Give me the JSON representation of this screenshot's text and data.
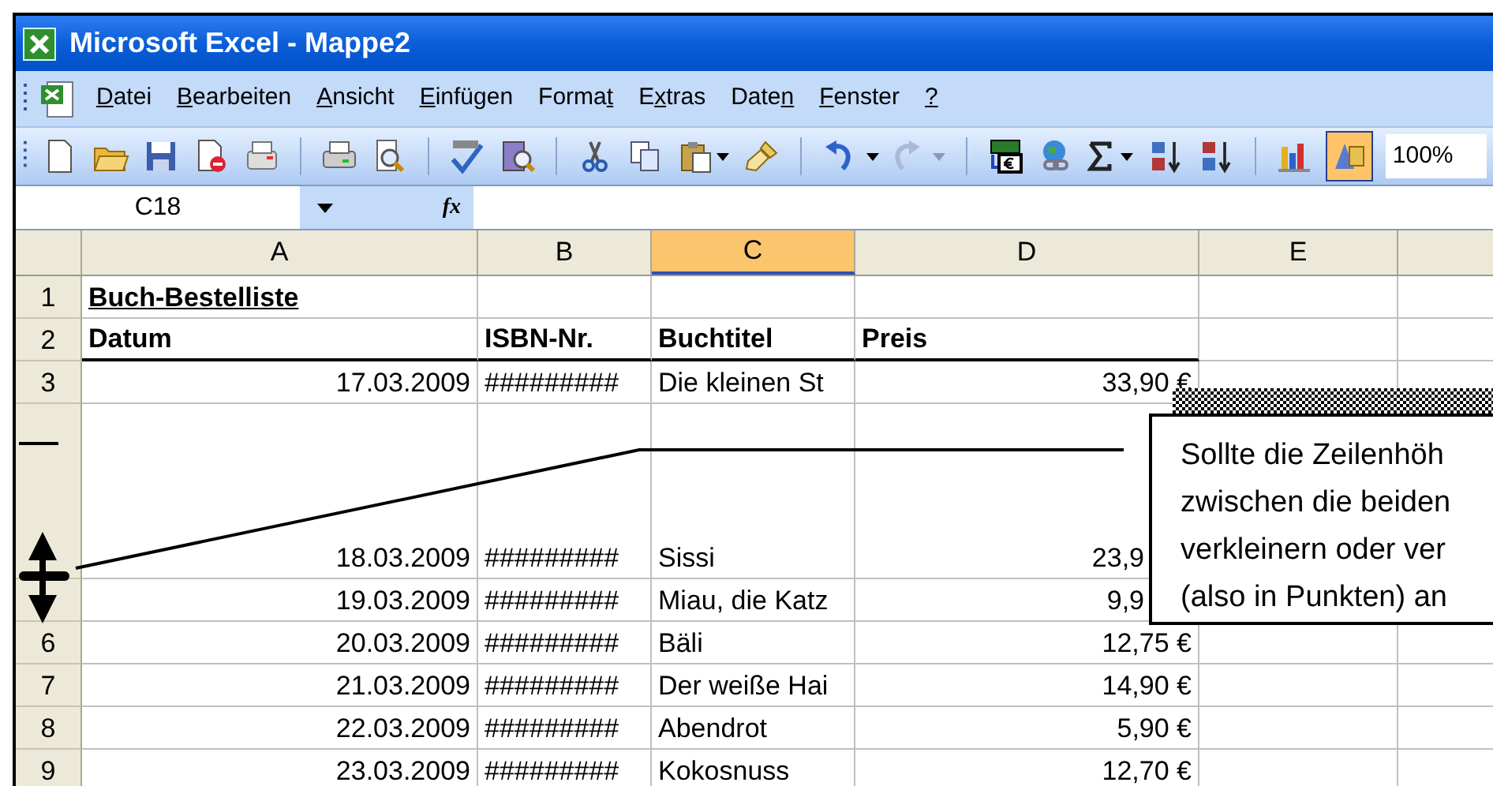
{
  "window": {
    "title": "Microsoft Excel - Mappe2"
  },
  "menu": [
    {
      "key": "D",
      "after": "atei"
    },
    {
      "key": "B",
      "after": "earbeiten"
    },
    {
      "key": "A",
      "after": "nsicht"
    },
    {
      "key": "E",
      "after": "infügen"
    },
    {
      "before": "Forma",
      "key": "t"
    },
    {
      "before": "E",
      "key": "x",
      "after": "tras"
    },
    {
      "before": "Date",
      "key": "n"
    },
    {
      "key": "F",
      "after": "enster"
    },
    {
      "key": "?"
    }
  ],
  "toolbar": {
    "zoom": "100%",
    "drawing_pressed": true
  },
  "name_box": "C18",
  "formula_bar": {
    "fx": "fx"
  },
  "columns": [
    {
      "label": "A",
      "selected": false
    },
    {
      "label": "B",
      "selected": false
    },
    {
      "label": "C",
      "selected": true
    },
    {
      "label": "D",
      "selected": false
    },
    {
      "label": "E",
      "selected": false
    }
  ],
  "rows": [
    {
      "label": "1",
      "kind": "title",
      "tall": false,
      "behind_callout": false,
      "cells": [
        "Buch-Bestelliste"
      ]
    },
    {
      "label": "2",
      "kind": "header",
      "tall": false,
      "behind_callout": false,
      "cells": [
        "Datum",
        "ISBN-Nr.",
        "Buchtitel",
        "Preis"
      ]
    },
    {
      "label": "3",
      "kind": "data",
      "tall": false,
      "behind_callout": false,
      "cells": [
        "17.03.2009",
        "#########",
        "Die kleinen St",
        "33,90 €"
      ]
    },
    {
      "kind": "data",
      "tall": true,
      "behind_callout": true,
      "cells": [
        "18.03.2009",
        "#########",
        "Sissi",
        "23,9"
      ]
    },
    {
      "kind": "data",
      "tall": false,
      "behind_callout": true,
      "cells": [
        "19.03.2009",
        "#########",
        "Miau, die Katz",
        "9,9"
      ]
    },
    {
      "label": "6",
      "kind": "data",
      "tall": false,
      "behind_callout": false,
      "cells": [
        "20.03.2009",
        "#########",
        "Bäli",
        "12,75 €"
      ]
    },
    {
      "label": "7",
      "kind": "data",
      "tall": false,
      "behind_callout": false,
      "cells": [
        "21.03.2009",
        "#########",
        "Der weiße Hai",
        "14,90 €"
      ]
    },
    {
      "label": "8",
      "kind": "data",
      "tall": false,
      "behind_callout": false,
      "cells": [
        "22.03.2009",
        "#########",
        "Abendrot",
        "5,90 €"
      ]
    },
    {
      "label": "9",
      "kind": "data",
      "tall": false,
      "behind_callout": false,
      "cells": [
        "23.03.2009",
        "#########",
        "Kokosnuss",
        "12,70 €"
      ]
    }
  ],
  "callout": {
    "lines": [
      "Sollte die Zeilenhöh",
      "zwischen die beiden",
      "verkleinern oder ver",
      "(also in Punkten) an"
    ]
  }
}
